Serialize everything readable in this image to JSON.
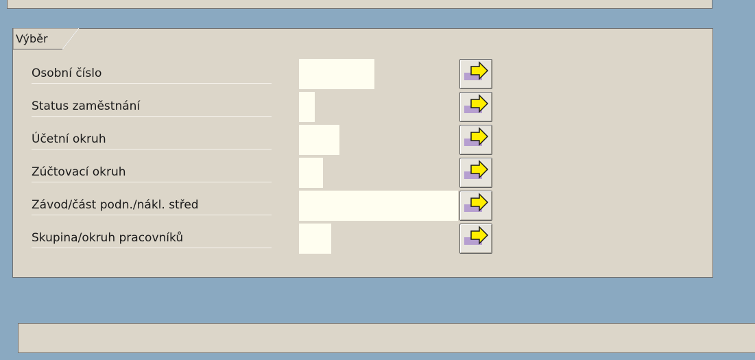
{
  "group": {
    "title": "Výběr"
  },
  "rows": [
    {
      "label": "Osobní číslo",
      "value": "",
      "button_icon": "arrow-right-icon"
    },
    {
      "label": "Status zaměstnání",
      "value": "",
      "button_icon": "arrow-right-icon"
    },
    {
      "label": "Účetní okruh",
      "value": "",
      "button_icon": "arrow-right-icon"
    },
    {
      "label": "Zúčtovací okruh",
      "value": "",
      "button_icon": "arrow-right-icon"
    },
    {
      "label": "Závod/část podn./nákl. střed",
      "value": "",
      "button_icon": "arrow-right-icon"
    },
    {
      "label": "Skupina/okruh pracovníků",
      "value": "",
      "button_icon": "arrow-right-icon"
    }
  ],
  "status_bar": {
    "text": ""
  },
  "colors": {
    "background": "#8aa9c1",
    "panel": "#dcd6c9",
    "input": "#fffef0",
    "arrow": "#ffee00",
    "arrow_bar": "#b69fd0"
  }
}
